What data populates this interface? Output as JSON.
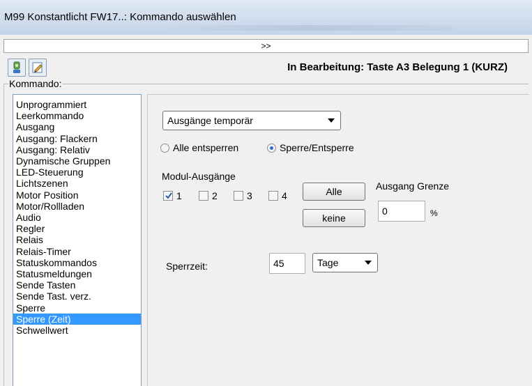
{
  "window": {
    "title": "M99 Konstantlicht FW17..: Kommando auswählen"
  },
  "expand": {
    "label": ">>"
  },
  "toolbar": {
    "status": "In Bearbeitung: Taste A3 Belegung 1 (KURZ)",
    "icons": [
      "device-icon",
      "edit-icon"
    ]
  },
  "group": {
    "label": "Kommando:"
  },
  "commands": [
    "Unprogrammiert",
    "Leerkommando",
    "Ausgang",
    "Ausgang: Flackern",
    "Ausgang: Relativ",
    "Dynamische Gruppen",
    "LED-Steuerung",
    "Lichtszenen",
    "Motor Position",
    "Motor/Rollladen",
    "Audio",
    "Regler",
    "Relais",
    "Relais-Timer",
    "Statuskommandos",
    "Statusmeldungen",
    "Sende Tasten",
    "Sende Tast. verz.",
    "Sperre",
    "Sperre (Zeit)",
    "Schwellwert"
  ],
  "selected_command": "Sperre (Zeit)",
  "panel": {
    "mode_select": {
      "value": "Ausgänge temporär"
    },
    "radio_unlock_all": {
      "label": "Alle entsperren",
      "checked": false
    },
    "radio_lock_unlock": {
      "label": "Sperre/Entsperre",
      "checked": true
    },
    "outputs_label": "Modul-Ausgänge",
    "outputs": [
      {
        "label": "1",
        "checked": true
      },
      {
        "label": "2",
        "checked": false
      },
      {
        "label": "3",
        "checked": false
      },
      {
        "label": "4",
        "checked": false
      }
    ],
    "all_button": "Alle",
    "none_button": "keine",
    "limit_label": "Ausgang Grenze",
    "limit_value": "0",
    "limit_unit": "%",
    "lock_time_label": "Sperrzeit:",
    "lock_time_value": "45",
    "lock_time_unit": "Tage"
  }
}
